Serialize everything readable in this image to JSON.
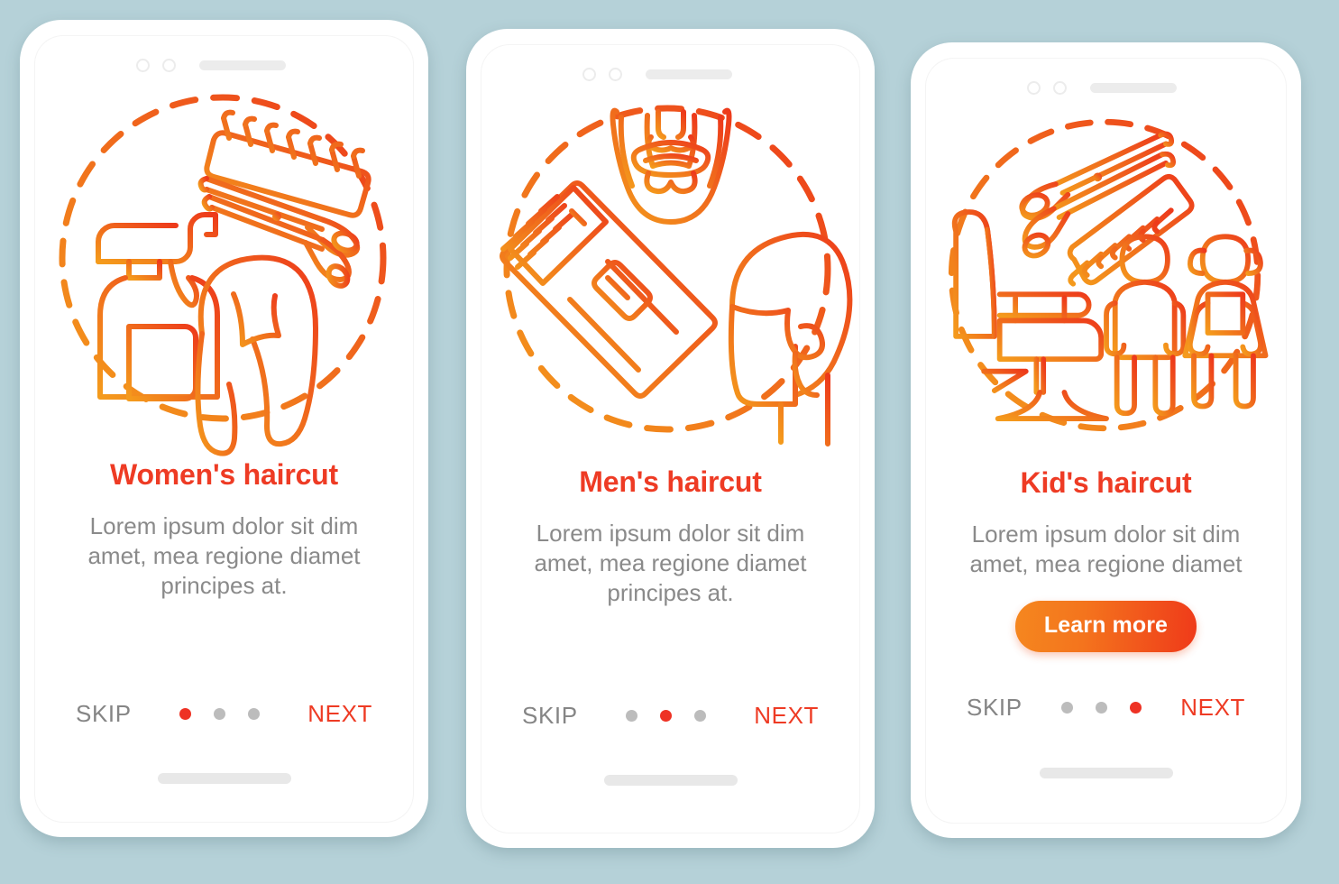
{
  "background_color": "#b5d1d8",
  "theme": {
    "accent_red": "#ee3b24",
    "accent_orange": "#f5871f",
    "muted_text": "#8a8a8a",
    "dot_inactive": "#bcbcbc",
    "dot_active": "#ee3224"
  },
  "screens": [
    {
      "id": "womens-haircut",
      "title": "Women's haircut",
      "description": "Lorem ipsum dolor sit dim amet, mea regione diamet principes at.",
      "cta": null,
      "skip_label": "SKIP",
      "next_label": "NEXT",
      "dots": {
        "count": 3,
        "active_index": 0
      },
      "illustration_items": [
        "spray-bottle-icon",
        "comb-icon",
        "scissors-icon",
        "wig-hairstyle-icon",
        "dashed-circle"
      ]
    },
    {
      "id": "mens-haircut",
      "title": "Men's haircut",
      "description": "Lorem ipsum dolor sit dim amet, mea regione diamet principes at.",
      "cta": null,
      "skip_label": "SKIP",
      "next_label": "NEXT",
      "dots": {
        "count": 3,
        "active_index": 1
      },
      "illustration_items": [
        "beard-mustache-icon",
        "hair-clipper-icon",
        "mans-head-profile-icon",
        "dashed-circle"
      ]
    },
    {
      "id": "kids-haircut",
      "title": "Kid's haircut",
      "description": "Lorem ipsum dolor sit dim amet, mea regione diamet",
      "cta": "Learn more",
      "skip_label": "SKIP",
      "next_label": "NEXT",
      "dots": {
        "count": 3,
        "active_index": 2
      },
      "illustration_items": [
        "scissors-icon",
        "comb-icon",
        "barber-chair-icon",
        "boy-figure-icon",
        "girl-figure-icon",
        "dashed-circle"
      ]
    }
  ]
}
